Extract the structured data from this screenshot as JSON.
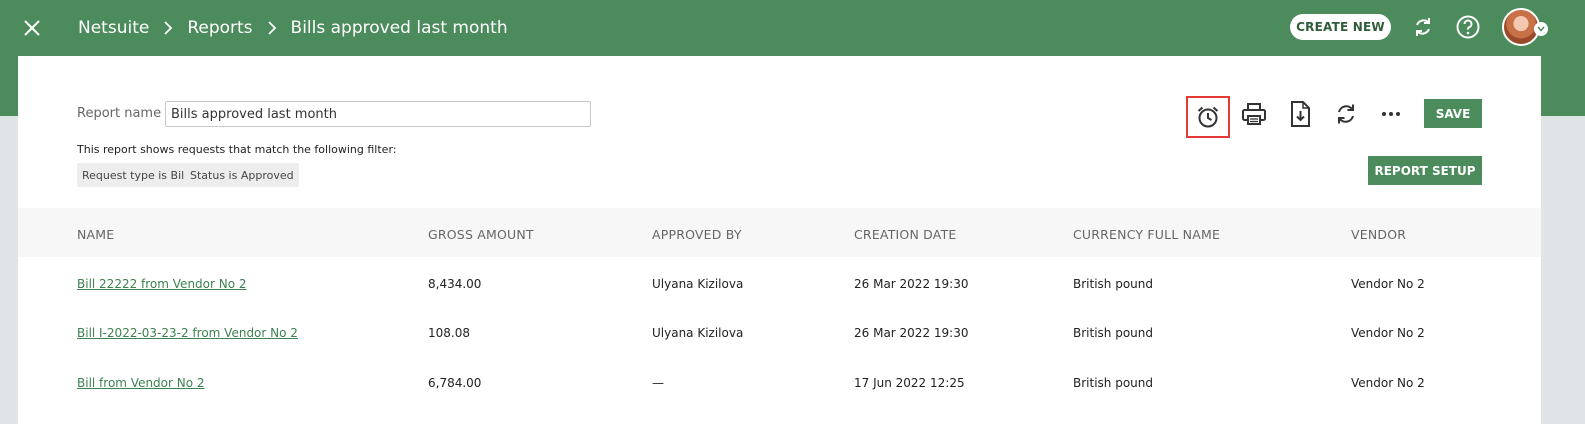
{
  "header": {
    "breadcrumbs": [
      "Netsuite",
      "Reports",
      "Bills approved last month"
    ],
    "create_new_label": "CREATE NEW",
    "icons": [
      "close-icon",
      "sync-icon",
      "help-icon",
      "avatar"
    ]
  },
  "report": {
    "name_label": "Report name",
    "name_value": "Bills approved last month",
    "filter_description": "This report shows requests that match the following filter:",
    "filters": [
      "Request type is Bill",
      "Status is Approved"
    ]
  },
  "toolbar": {
    "icons": [
      "alarm-clock-icon",
      "print-icon",
      "download-file-icon",
      "refresh-icon",
      "more-icon"
    ],
    "save_label": "SAVE",
    "report_setup_label": "REPORT SETUP"
  },
  "table": {
    "columns": [
      "NAME",
      "GROSS AMOUNT",
      "APPROVED BY",
      "CREATION DATE",
      "CURRENCY FULL NAME",
      "VENDOR"
    ],
    "rows": [
      [
        "Bill 22222 from Vendor No 2",
        "8,434.00",
        "Ulyana Kizilova",
        "26 Mar 2022 19:30",
        "British pound",
        "Vendor No 2"
      ],
      [
        "Bill I-2022-03-23-2 from Vendor No 2",
        "108.08",
        "Ulyana Kizilova",
        "26 Mar 2022 19:30",
        "British pound",
        "Vendor No 2"
      ],
      [
        "Bill from Vendor No 2",
        "6,784.00",
        "—",
        "17 Jun 2022 12:25",
        "British pound",
        "Vendor No 2"
      ]
    ]
  },
  "colors": {
    "brand_green": "#4b8b5c",
    "link_green": "#3e8152",
    "highlight_red": "#e53935"
  }
}
